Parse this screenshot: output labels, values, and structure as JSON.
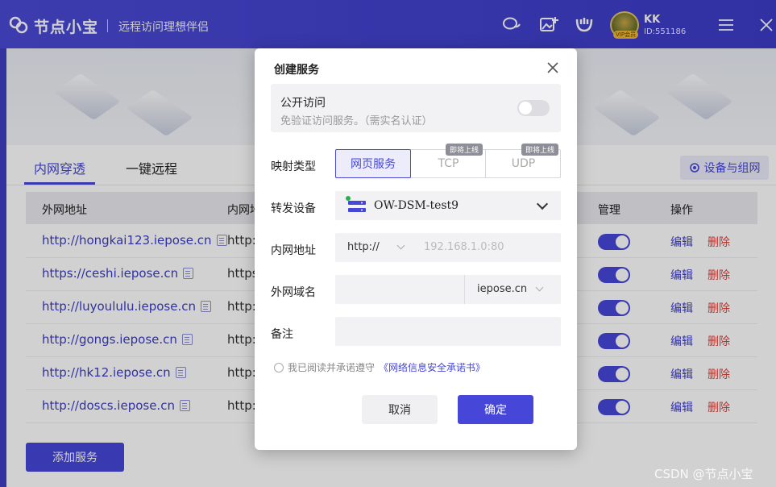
{
  "titlebar": {
    "app_name": "节点小宝",
    "slogan": "远程访问理想伴侣",
    "user_name": "KK",
    "user_id": "ID:551186",
    "vip_badge": "VIP会员"
  },
  "tabs": [
    {
      "label": "内网穿透",
      "active": true
    },
    {
      "label": "一键远程",
      "active": false
    }
  ],
  "device_group_button": "设备与组网",
  "table": {
    "headers": {
      "external": "外网地址",
      "internal": "内网地",
      "manage": "管理",
      "actions": "操作"
    },
    "rows": [
      {
        "external": "http://hongkai123.iepose.cn",
        "internal": "http:"
      },
      {
        "external": "https://ceshi.iepose.cn",
        "internal": "https"
      },
      {
        "external": "http://luyoululu.iepose.cn",
        "internal": "http:/"
      },
      {
        "external": "http://gongs.iepose.cn",
        "internal": "http:/"
      },
      {
        "external": "http://hk12.iepose.cn",
        "internal": "http:/"
      },
      {
        "external": "http://doscs.iepose.cn",
        "internal": "http:/"
      }
    ],
    "edit_label": "编辑",
    "delete_label": "删除"
  },
  "add_service_button": "添加服务",
  "modal": {
    "title": "创建服务",
    "public_access": {
      "title": "公开访问",
      "desc": "免验证访问服务。（需实名认证）",
      "enabled": false
    },
    "mapping_type_label": "映射类型",
    "mapping_types": [
      {
        "label": "网页服务",
        "active": true,
        "badge": ""
      },
      {
        "label": "TCP",
        "active": false,
        "badge": "即将上线"
      },
      {
        "label": "UDP",
        "active": false,
        "badge": "即将上线"
      }
    ],
    "forward_device_label": "转发设备",
    "forward_device_value": "OW-DSM-test9",
    "internal_address_label": "内网地址",
    "protocol_value": "http://",
    "internal_placeholder": "192.168.1.0:80",
    "external_domain_label": "外网域名",
    "domain_suffix": "iepose.cn",
    "remark_label": "备注",
    "agree_text": "我已阅读并承诺遵守",
    "agree_link": "《网络信息安全承诺书》",
    "cancel_label": "取消",
    "ok_label": "确定"
  },
  "watermark": "CSDN @节点小宝",
  "colors": {
    "accent": "#4646d9",
    "danger": "#e2403a",
    "online": "#27b34b"
  }
}
